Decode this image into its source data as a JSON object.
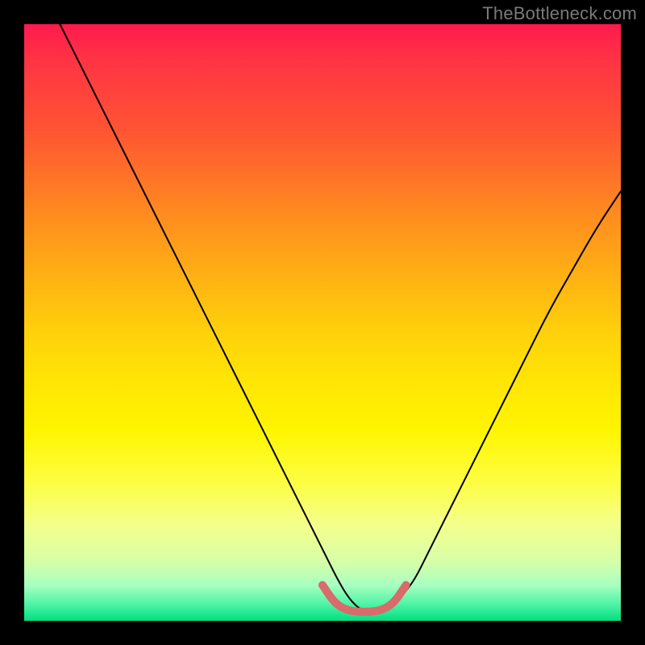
{
  "watermark": "TheBottleneck.com",
  "chart_data": {
    "type": "line",
    "title": "",
    "xlabel": "",
    "ylabel": "",
    "xlim": [
      0,
      100
    ],
    "ylim": [
      0,
      100
    ],
    "series": [
      {
        "name": "curve",
        "color": "#000000",
        "x": [
          6,
          10,
          14,
          18,
          22,
          26,
          30,
          34,
          38,
          42,
          46,
          50,
          53,
          55,
          57,
          59,
          62,
          65,
          68,
          72,
          76,
          80,
          84,
          88,
          92,
          96,
          100
        ],
        "y": [
          100,
          92,
          84,
          76,
          68,
          60,
          52,
          44,
          36,
          28,
          20,
          12,
          6,
          3,
          1.5,
          1.5,
          3,
          6,
          12,
          20,
          28,
          36,
          44,
          52,
          59,
          66,
          72
        ]
      },
      {
        "name": "highlight",
        "color": "#e07070",
        "x": [
          50,
          52,
          54,
          56,
          58,
          60,
          62,
          64
        ],
        "y": [
          6,
          3,
          1.8,
          1.5,
          1.5,
          1.8,
          3,
          6
        ]
      }
    ],
    "gradient_stops": [
      {
        "pos": 0,
        "color": "#ff1a4d"
      },
      {
        "pos": 50,
        "color": "#ffe000"
      },
      {
        "pos": 100,
        "color": "#00e080"
      }
    ]
  }
}
